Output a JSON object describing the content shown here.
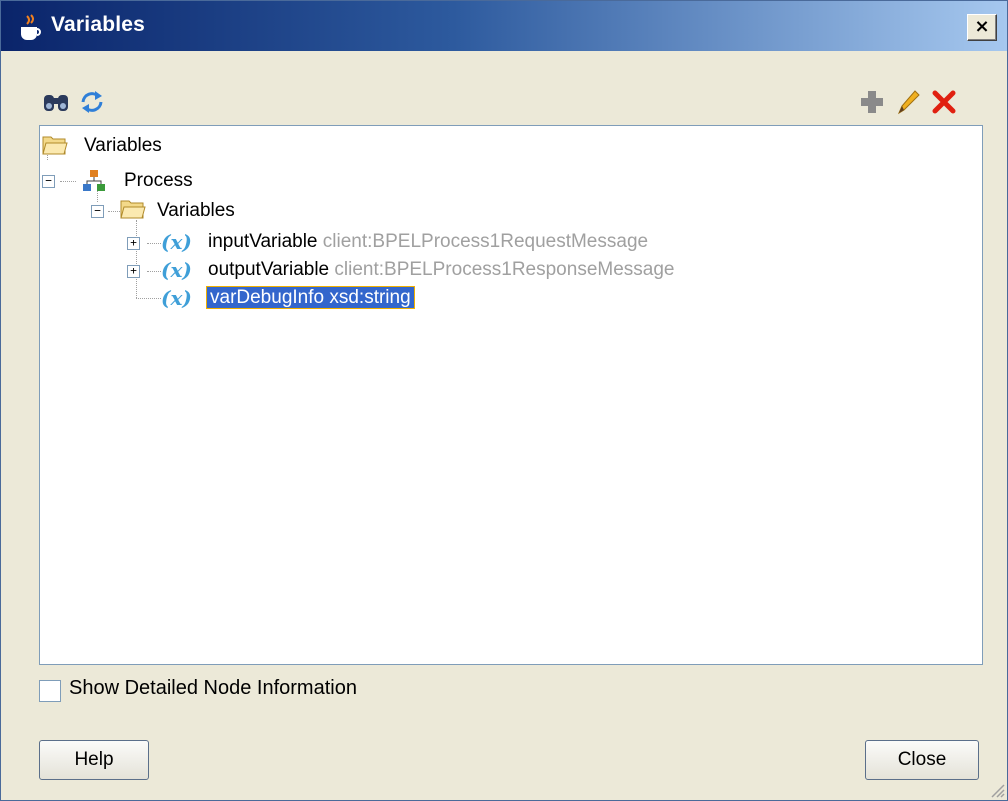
{
  "window": {
    "title": "Variables",
    "close_glyph": "×"
  },
  "toolbar": {
    "left_icons": [
      "binoculars-icon",
      "refresh-icon"
    ],
    "right_icons": [
      "add-icon",
      "edit-icon",
      "delete-icon"
    ]
  },
  "tree": {
    "root_label": "Variables",
    "process_label": "Process",
    "variables_folder_label": "Variables",
    "variable_marker": "(x)",
    "variables": [
      {
        "name": "inputVariable",
        "type": "client:BPELProcess1RequestMessage"
      },
      {
        "name": "outputVariable",
        "type": "client:BPELProcess1ResponseMessage"
      },
      {
        "name": "varDebugInfo",
        "type": "xsd:string",
        "selected": true
      }
    ]
  },
  "options": {
    "show_detailed_label": "Show Detailed Node Information",
    "show_detailed_checked": false
  },
  "buttons": {
    "help_label": "Help",
    "close_label": "Close"
  },
  "colors": {
    "title_start": "#0a246a",
    "title_end": "#a6c8ef",
    "selection": "#3366cc",
    "type_text": "#a0a0a0",
    "variable_marker": "#3f9fd8"
  }
}
